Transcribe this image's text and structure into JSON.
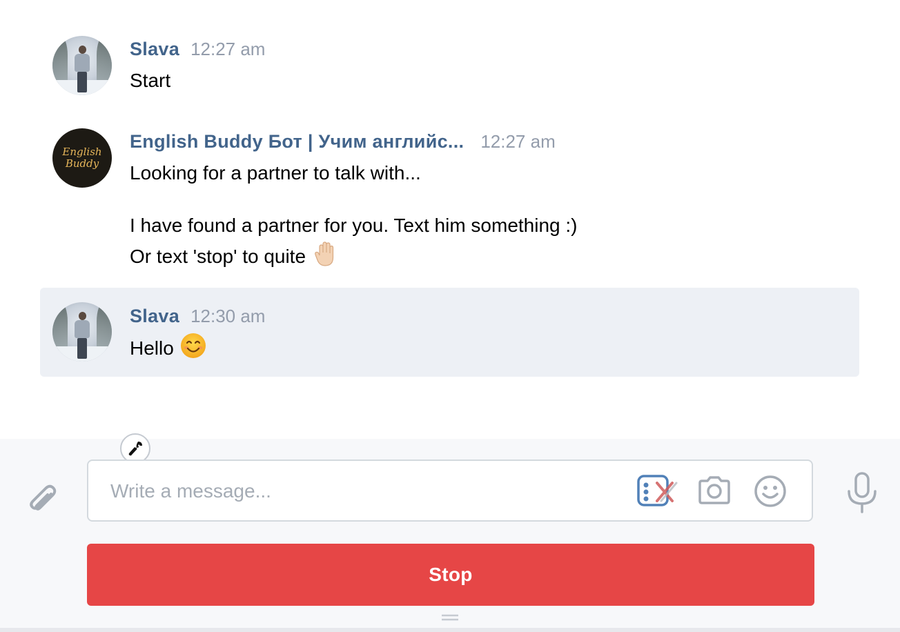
{
  "messages": [
    {
      "author": "Slava",
      "time": "12:27 am",
      "lines": [
        "Start"
      ]
    },
    {
      "author": "English Buddy Бот | Учим английс...",
      "time": "12:27 am",
      "avatar_text": [
        "English",
        "Buddy"
      ],
      "lines": [
        "Looking for a partner to talk with...",
        "I have found a partner for you. Text him something :)",
        "Or text 'stop' to quite"
      ],
      "emoji": "raised-hand"
    },
    {
      "author": "Slava",
      "time": "12:30 am",
      "lines": [
        "Hello"
      ],
      "emoji": "smiling-face",
      "highlighted": true
    }
  ],
  "composer": {
    "placeholder": "Write a message...",
    "stop_label": "Stop",
    "icons": [
      "paperclip-icon",
      "keyboard-icon",
      "camera-icon",
      "smile-icon",
      "microphone-icon",
      "wrench-icon",
      "drag-handle-icon"
    ]
  },
  "colors": {
    "author": "#42648b",
    "time": "#939cab",
    "highlight_bg": "#edf0f5",
    "stop_button": "#e64646",
    "composer_bg": "#f7f8fa",
    "icon": "#a5acb5",
    "keyboard_accent": "#5181b8"
  }
}
